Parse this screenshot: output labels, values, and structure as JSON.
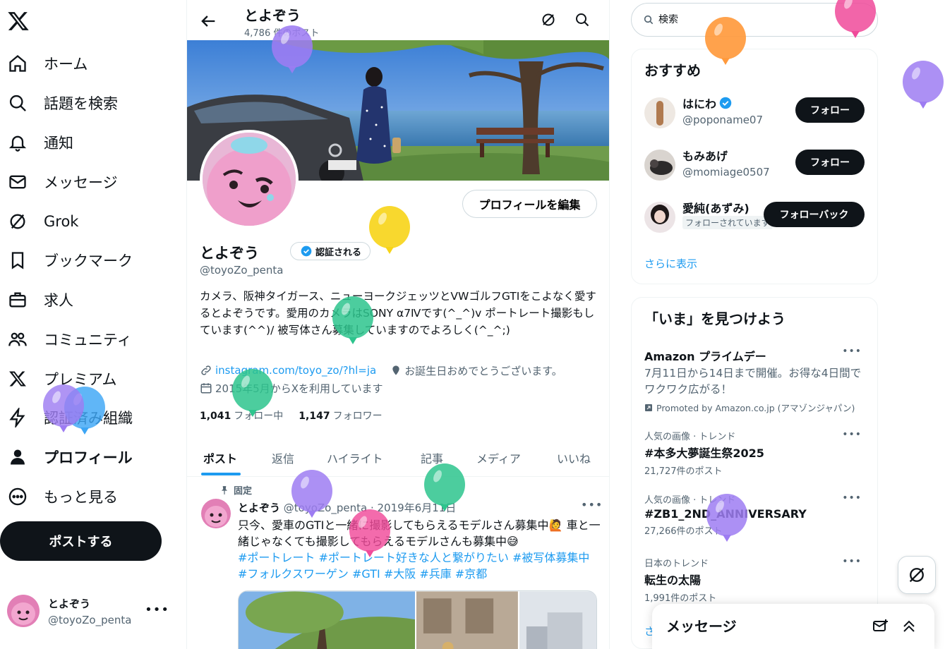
{
  "nav": {
    "items": [
      {
        "label": "ホーム",
        "icon": "home-icon"
      },
      {
        "label": "話題を検索",
        "icon": "search-icon"
      },
      {
        "label": "通知",
        "icon": "bell-icon"
      },
      {
        "label": "メッセージ",
        "icon": "mail-icon"
      },
      {
        "label": "Grok",
        "icon": "grok-icon"
      },
      {
        "label": "ブックマーク",
        "icon": "bookmark-icon"
      },
      {
        "label": "求人",
        "icon": "briefcase-icon"
      },
      {
        "label": "コミュニティ",
        "icon": "people-icon"
      },
      {
        "label": "プレミアム",
        "icon": "x-icon"
      },
      {
        "label": "認証済み組織",
        "icon": "lightning-icon"
      },
      {
        "label": "プロフィール",
        "icon": "person-icon",
        "active": true
      },
      {
        "label": "もっと見る",
        "icon": "more-circle-icon"
      }
    ],
    "post_button": "ポストする",
    "account": {
      "display_name": "とよぞう",
      "handle": "@toyoZo_penta"
    }
  },
  "header": {
    "title": "とよぞう",
    "post_count": "4,786 件のポスト"
  },
  "profile": {
    "edit_button": "プロフィールを編集",
    "display_name": "とよぞう",
    "verify_chip": "認証される",
    "handle": "@toyoZo_penta",
    "bio": "カメラ、阪神タイガース、ニューヨークジェッツとVWゴルフGTIをこよなく愛するとよぞうです。愛用のカメラはSONY α7Ⅳです(^_^)v ポートレート撮影もしています(^^)/ 被写体さん募集していますのでよろしく(^_^;)",
    "link": "instagram.com/toyo_zo/?hl=ja",
    "birthday": "お誕生日おめでとうございます。",
    "joined": "2015年5月からXを利用しています",
    "following_count": "1,041",
    "following_label": "フォロー中",
    "followers_count": "1,147",
    "followers_label": "フォロワー"
  },
  "tabs": [
    "ポスト",
    "返信",
    "ハイライト",
    "記事",
    "メディア",
    "いいね"
  ],
  "active_tab": "ポスト",
  "pinned_tweet": {
    "pinned_label": "固定",
    "display_name": "とよぞう",
    "meta": "@toyoZo_penta · 2019年6月11日",
    "text": "只今、愛車のGTIと一緒に撮影してもらえるモデルさん募集中🙋 車と一緒じゃなくても撮影してもらえるモデルさんも募集中😅",
    "hashtags": "#ポートレート #ポートレート好きな人と繋がりたい #被写体募集中 #フォルクスワーゲン #GTI #大阪 #兵庫 #京都"
  },
  "search": {
    "placeholder": "検索"
  },
  "suggestions": {
    "title": "おすすめ",
    "items": [
      {
        "name": "はにわ",
        "handle": "@poponame07",
        "verified": true,
        "button": "フォロー"
      },
      {
        "name": "もみあげ",
        "handle": "@momiage0507",
        "verified": false,
        "button": "フォロー"
      },
      {
        "name": "愛純(あずみ)",
        "tag": "フォローされています",
        "button": "フォローバック"
      }
    ],
    "more": "さらに表示"
  },
  "trends": {
    "title": "「いま」を見つけよう",
    "items": [
      {
        "title": "Amazon プライムデー",
        "body": "7月11日から14日まで開催。お得な4日間でワクワク広がる！",
        "promo": "Promoted by Amazon.co.jp (アマゾンジャパン)"
      },
      {
        "context": "人気の画像 · トレンド",
        "title": "#本多大夢誕生祭2025",
        "count": "21,727件のポスト"
      },
      {
        "context": "人気の画像 · トレンド",
        "title": "#ZB1_2ND_ANNIVERSARY",
        "count": "27,266件のポスト"
      },
      {
        "context": "日本のトレンド",
        "title": "転生の太陽",
        "count": "1,991件のポスト"
      }
    ],
    "more": "さ"
  },
  "messages_drawer": {
    "title": "メッセージ"
  },
  "colors": {
    "accent": "#1d9bf0",
    "text": "#0f1419",
    "muted": "#536471",
    "button_dark": "#0f1419",
    "border": "#eff3f4"
  }
}
